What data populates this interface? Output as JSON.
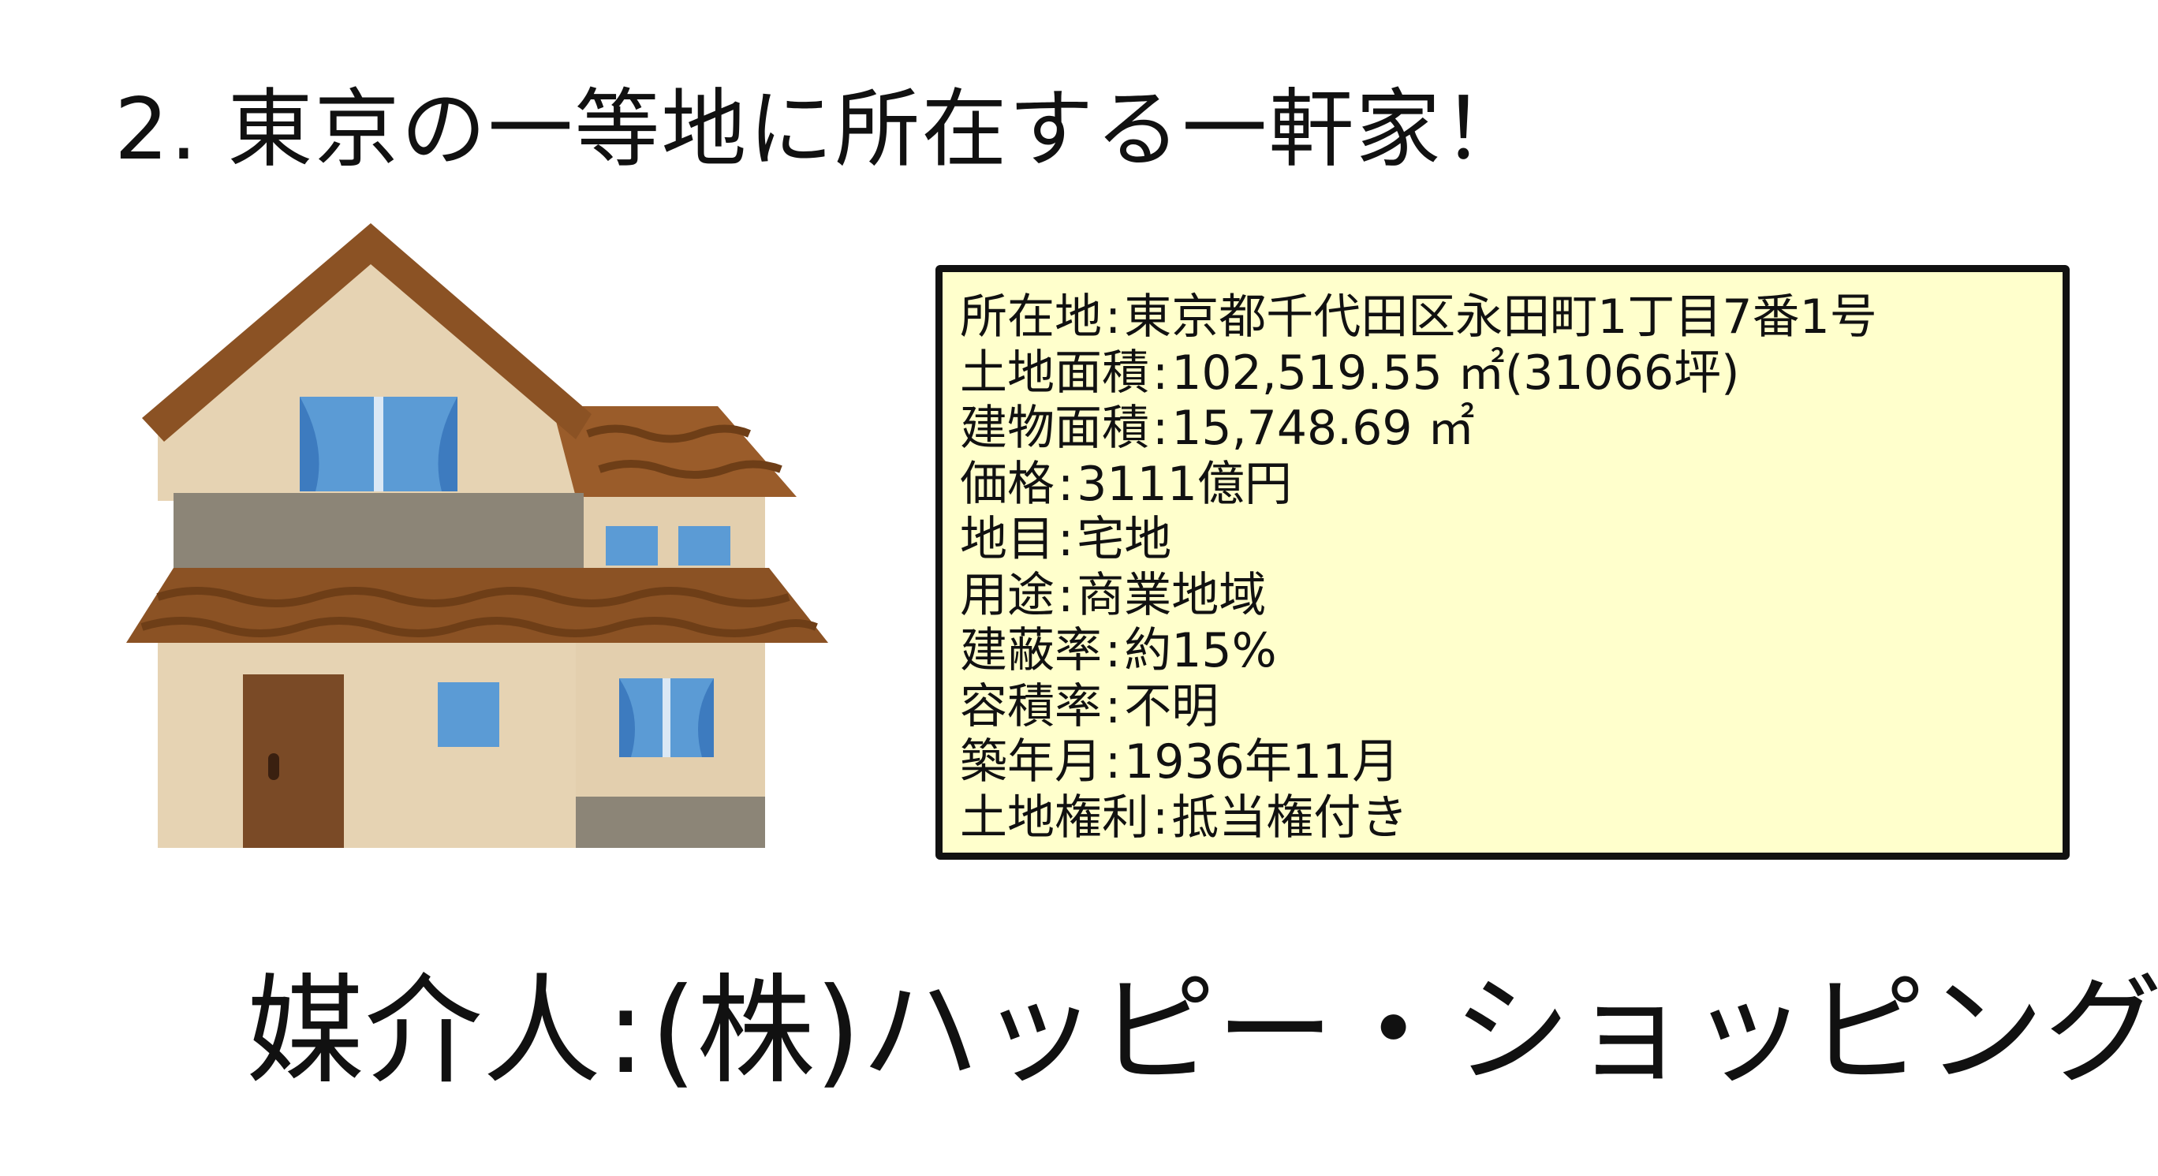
{
  "title": "2. 東京の一等地に所在する一軒家！",
  "property": [
    {
      "label": "所在地",
      "value": "東京都千代田区永田町1丁目7番1号"
    },
    {
      "label": "土地面積",
      "value": "102,519.55 ㎡(31066坪)"
    },
    {
      "label": "建物面積",
      "value": "15,748.69 ㎡"
    },
    {
      "label": "価格",
      "value": "3111億円"
    },
    {
      "label": "地目",
      "value": "宅地"
    },
    {
      "label": "用途",
      "value": "商業地域"
    },
    {
      "label": "建蔽率",
      "value": "約15%"
    },
    {
      "label": "容積率",
      "value": "不明"
    },
    {
      "label": "築年月",
      "value": "1936年11月"
    },
    {
      "label": "土地権利",
      "value": "抵当権付き"
    }
  ],
  "broker": {
    "label": "媒介人",
    "value": "(株)ハッピー・ショッピング"
  },
  "colors": {
    "box_background": "#ffffcc",
    "roof": "#8b5224",
    "wall": "#e6d3b3",
    "window": "#5b9bd5",
    "door": "#7a4a26"
  },
  "icons": {
    "illustration": "house-icon"
  }
}
